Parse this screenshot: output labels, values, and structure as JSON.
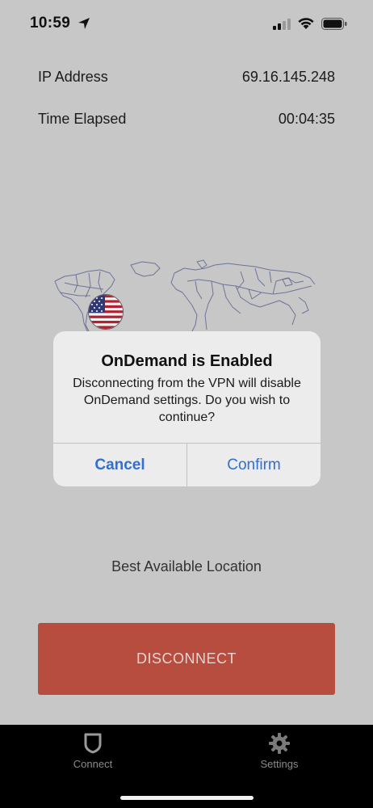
{
  "status": {
    "time": "10:59"
  },
  "info": {
    "ip_label": "IP Address",
    "ip_value": "69.16.145.248",
    "time_label": "Time Elapsed",
    "time_value": "00:04:35"
  },
  "dialog": {
    "title": "OnDemand is Enabled",
    "message": "Disconnecting from the VPN will disable OnDemand settings. Do you wish to continue?",
    "cancel_label": "Cancel",
    "confirm_label": "Confirm"
  },
  "location": {
    "label": "Best Available Location"
  },
  "action": {
    "disconnect_label": "DISCONNECT"
  },
  "tabbar": {
    "items": [
      {
        "label": "Connect",
        "icon": "shield-icon"
      },
      {
        "label": "Settings",
        "icon": "gear-icon"
      }
    ]
  },
  "colors": {
    "background": "#c7c7c8",
    "disconnect": "#b74d3e",
    "dialog_button": "#2f6fd6",
    "tabbar": "#000000"
  }
}
